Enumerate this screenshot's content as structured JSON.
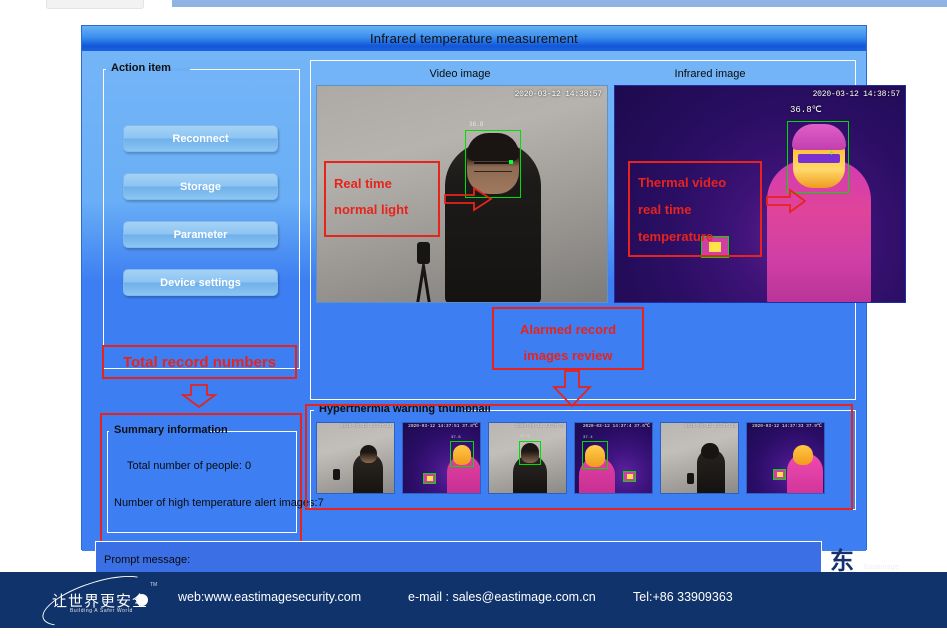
{
  "window": {
    "title": "Infrared temperature measurement"
  },
  "left_panel": {
    "action_group_label": "Action item",
    "buttons": [
      {
        "label": "Reconnect",
        "name": "reconnect-button"
      },
      {
        "label": "Storage",
        "name": "storage-button"
      },
      {
        "label": "Parameter",
        "name": "parameter-button"
      },
      {
        "label": "Device settings",
        "name": "device-settings-button"
      }
    ],
    "annotation_total_records": "Total record numbers",
    "summary": {
      "group_label": "Summary information",
      "total_people_line": "Total number of people:    0",
      "alert_images_line": "Number of high temperature alert images:7",
      "total_people_value": "0",
      "alert_images_value": "7"
    }
  },
  "live_view": {
    "video_title": "Video image",
    "infrared_title": "Infrared image",
    "video_timestamp": "2020-03-12 14:38:57",
    "infrared_timestamp": "2020-03-12 14:38:57",
    "face_label": "36.8",
    "infrared_temperature": "36.8℃",
    "annotation_video": {
      "line1": "Real time",
      "line2": "normal light"
    },
    "annotation_infrared": {
      "line1": "Thermal video",
      "line2": "real time",
      "line3": "temperature"
    },
    "annotation_review": {
      "line1": "Alarmed record",
      "line2": "images review"
    }
  },
  "thumbnails": {
    "group_label": "Hyperthermia warning thumbnail",
    "items": [
      {
        "kind": "visible",
        "timestamp": "2020-03-12 14:37:51"
      },
      {
        "kind": "infrared",
        "timestamp": "2020-03-12 14:37:51  37.8℃"
      },
      {
        "kind": "visible",
        "timestamp": "2020-03-12 14:37:4"
      },
      {
        "kind": "infrared",
        "timestamp": "2020-03-12 14:37:4  37.6℃"
      },
      {
        "kind": "visible",
        "timestamp": "2020-03-12 14:37:33"
      },
      {
        "kind": "infrared",
        "timestamp": "2020-03-12 14:37:33  37.9℃"
      }
    ]
  },
  "prompt": {
    "label": "Prompt message:",
    "value": ""
  },
  "corner_logo": {
    "mark": "东",
    "text": "Eastimage"
  },
  "footer": {
    "logo_cn": "让世界更安全",
    "logo_en": "Building A Safer World",
    "trademark": "TM",
    "web": "web:www.eastimagesecurity.com",
    "email": "e-mail : sales@eastimage.com.cn",
    "tel": "Tel:+86 33909363"
  },
  "colors": {
    "window_bg": "#3d7ff2",
    "title_bar": "#1257d8",
    "annotation_red": "#e8231c",
    "footer_bg": "#10336b",
    "detect_box_green": "#00dd00"
  }
}
